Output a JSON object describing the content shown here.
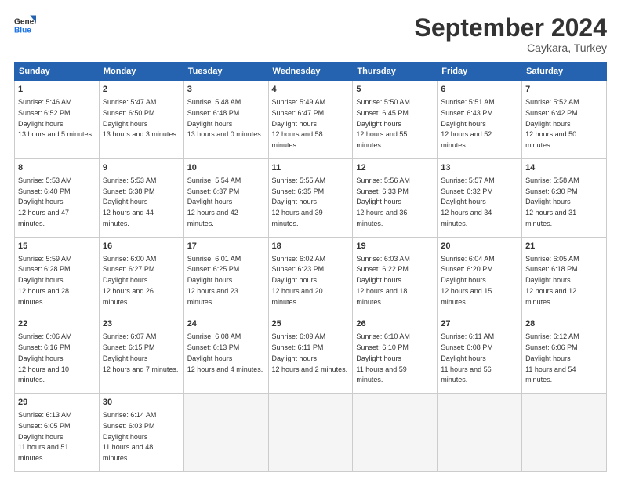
{
  "logo": {
    "line1": "General",
    "line2": "Blue"
  },
  "title": "September 2024",
  "location": "Caykara, Turkey",
  "days_of_week": [
    "Sunday",
    "Monday",
    "Tuesday",
    "Wednesday",
    "Thursday",
    "Friday",
    "Saturday"
  ],
  "weeks": [
    [
      {
        "day": "1",
        "sunrise": "5:46 AM",
        "sunset": "6:52 PM",
        "daylight": "13 hours and 5 minutes."
      },
      {
        "day": "2",
        "sunrise": "5:47 AM",
        "sunset": "6:50 PM",
        "daylight": "13 hours and 3 minutes."
      },
      {
        "day": "3",
        "sunrise": "5:48 AM",
        "sunset": "6:48 PM",
        "daylight": "13 hours and 0 minutes."
      },
      {
        "day": "4",
        "sunrise": "5:49 AM",
        "sunset": "6:47 PM",
        "daylight": "12 hours and 58 minutes."
      },
      {
        "day": "5",
        "sunrise": "5:50 AM",
        "sunset": "6:45 PM",
        "daylight": "12 hours and 55 minutes."
      },
      {
        "day": "6",
        "sunrise": "5:51 AM",
        "sunset": "6:43 PM",
        "daylight": "12 hours and 52 minutes."
      },
      {
        "day": "7",
        "sunrise": "5:52 AM",
        "sunset": "6:42 PM",
        "daylight": "12 hours and 50 minutes."
      }
    ],
    [
      {
        "day": "8",
        "sunrise": "5:53 AM",
        "sunset": "6:40 PM",
        "daylight": "12 hours and 47 minutes."
      },
      {
        "day": "9",
        "sunrise": "5:53 AM",
        "sunset": "6:38 PM",
        "daylight": "12 hours and 44 minutes."
      },
      {
        "day": "10",
        "sunrise": "5:54 AM",
        "sunset": "6:37 PM",
        "daylight": "12 hours and 42 minutes."
      },
      {
        "day": "11",
        "sunrise": "5:55 AM",
        "sunset": "6:35 PM",
        "daylight": "12 hours and 39 minutes."
      },
      {
        "day": "12",
        "sunrise": "5:56 AM",
        "sunset": "6:33 PM",
        "daylight": "12 hours and 36 minutes."
      },
      {
        "day": "13",
        "sunrise": "5:57 AM",
        "sunset": "6:32 PM",
        "daylight": "12 hours and 34 minutes."
      },
      {
        "day": "14",
        "sunrise": "5:58 AM",
        "sunset": "6:30 PM",
        "daylight": "12 hours and 31 minutes."
      }
    ],
    [
      {
        "day": "15",
        "sunrise": "5:59 AM",
        "sunset": "6:28 PM",
        "daylight": "12 hours and 28 minutes."
      },
      {
        "day": "16",
        "sunrise": "6:00 AM",
        "sunset": "6:27 PM",
        "daylight": "12 hours and 26 minutes."
      },
      {
        "day": "17",
        "sunrise": "6:01 AM",
        "sunset": "6:25 PM",
        "daylight": "12 hours and 23 minutes."
      },
      {
        "day": "18",
        "sunrise": "6:02 AM",
        "sunset": "6:23 PM",
        "daylight": "12 hours and 20 minutes."
      },
      {
        "day": "19",
        "sunrise": "6:03 AM",
        "sunset": "6:22 PM",
        "daylight": "12 hours and 18 minutes."
      },
      {
        "day": "20",
        "sunrise": "6:04 AM",
        "sunset": "6:20 PM",
        "daylight": "12 hours and 15 minutes."
      },
      {
        "day": "21",
        "sunrise": "6:05 AM",
        "sunset": "6:18 PM",
        "daylight": "12 hours and 12 minutes."
      }
    ],
    [
      {
        "day": "22",
        "sunrise": "6:06 AM",
        "sunset": "6:16 PM",
        "daylight": "12 hours and 10 minutes."
      },
      {
        "day": "23",
        "sunrise": "6:07 AM",
        "sunset": "6:15 PM",
        "daylight": "12 hours and 7 minutes."
      },
      {
        "day": "24",
        "sunrise": "6:08 AM",
        "sunset": "6:13 PM",
        "daylight": "12 hours and 4 minutes."
      },
      {
        "day": "25",
        "sunrise": "6:09 AM",
        "sunset": "6:11 PM",
        "daylight": "12 hours and 2 minutes."
      },
      {
        "day": "26",
        "sunrise": "6:10 AM",
        "sunset": "6:10 PM",
        "daylight": "11 hours and 59 minutes."
      },
      {
        "day": "27",
        "sunrise": "6:11 AM",
        "sunset": "6:08 PM",
        "daylight": "11 hours and 56 minutes."
      },
      {
        "day": "28",
        "sunrise": "6:12 AM",
        "sunset": "6:06 PM",
        "daylight": "11 hours and 54 minutes."
      }
    ],
    [
      {
        "day": "29",
        "sunrise": "6:13 AM",
        "sunset": "6:05 PM",
        "daylight": "11 hours and 51 minutes."
      },
      {
        "day": "30",
        "sunrise": "6:14 AM",
        "sunset": "6:03 PM",
        "daylight": "11 hours and 48 minutes."
      },
      {
        "day": "",
        "sunrise": "",
        "sunset": "",
        "daylight": ""
      },
      {
        "day": "",
        "sunrise": "",
        "sunset": "",
        "daylight": ""
      },
      {
        "day": "",
        "sunrise": "",
        "sunset": "",
        "daylight": ""
      },
      {
        "day": "",
        "sunrise": "",
        "sunset": "",
        "daylight": ""
      },
      {
        "day": "",
        "sunrise": "",
        "sunset": "",
        "daylight": ""
      }
    ]
  ]
}
